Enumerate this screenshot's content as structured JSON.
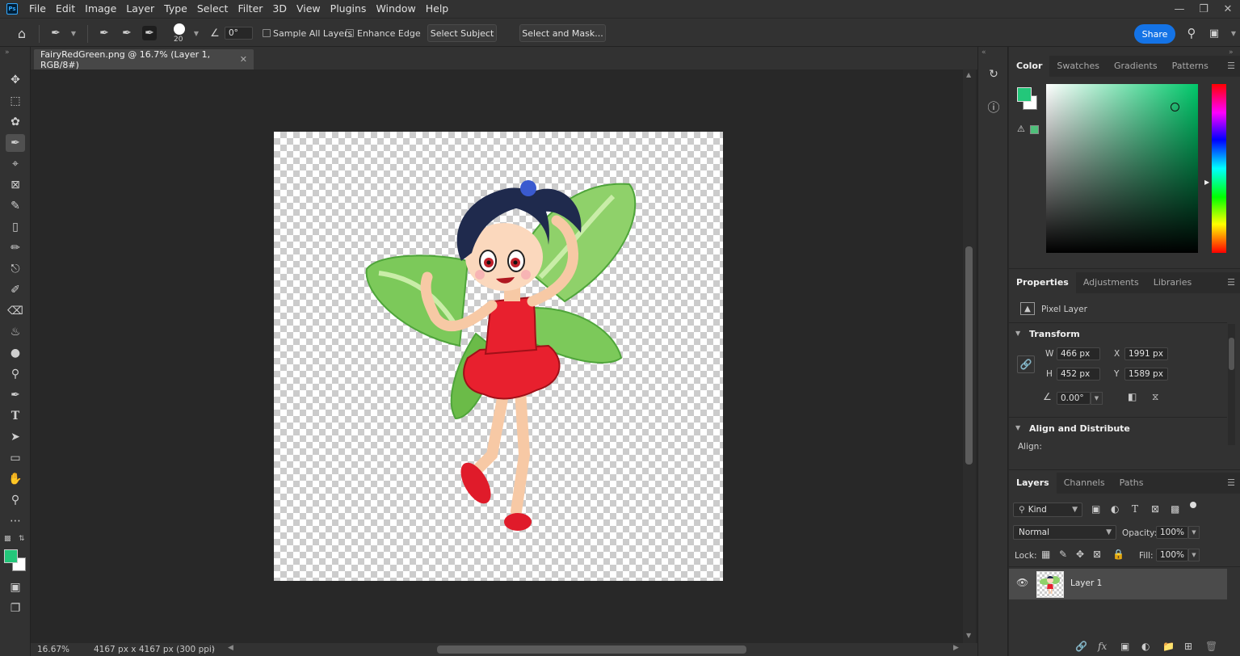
{
  "menubar": {
    "logo": "Ps",
    "items": [
      "File",
      "Edit",
      "Image",
      "Layer",
      "Type",
      "Select",
      "Filter",
      "3D",
      "View",
      "Plugins",
      "Window",
      "Help"
    ]
  },
  "options": {
    "brush_size": "20",
    "angle": "0°",
    "sample_all_layers": "Sample All Layers",
    "enhance_edge": "Enhance Edge",
    "select_subject": "Select Subject",
    "select_and_mask": "Select and Mask...",
    "share": "Share"
  },
  "document": {
    "tab_title": "FairyRedGreen.png @ 16.7% (Layer 1, RGB/8#)",
    "zoom": "16.67%",
    "dimensions": "4167 px x 4167 px (300 ppi)"
  },
  "colors": {
    "foreground": "#23c77a",
    "background": "#ffffff",
    "accent": "#1473e6"
  },
  "color_panel": {
    "tabs": [
      "Color",
      "Swatches",
      "Gradients",
      "Patterns"
    ]
  },
  "properties": {
    "tabs": [
      "Properties",
      "Adjustments",
      "Libraries"
    ],
    "layer_type": "Pixel Layer",
    "transform_title": "Transform",
    "w_label": "W",
    "w": "466 px",
    "h_label": "H",
    "h": "452 px",
    "x_label": "X",
    "x": "1991 px",
    "y_label": "Y",
    "y": "1589 px",
    "angle": "0.00°",
    "align_title": "Align and Distribute",
    "align_label": "Align:"
  },
  "layers": {
    "tabs": [
      "Layers",
      "Channels",
      "Paths"
    ],
    "kind": "Kind",
    "blend_mode": "Normal",
    "opacity_label": "Opacity:",
    "opacity": "100%",
    "lock_label": "Lock:",
    "fill_label": "Fill:",
    "fill": "100%",
    "items": [
      {
        "name": "Layer 1"
      }
    ]
  }
}
